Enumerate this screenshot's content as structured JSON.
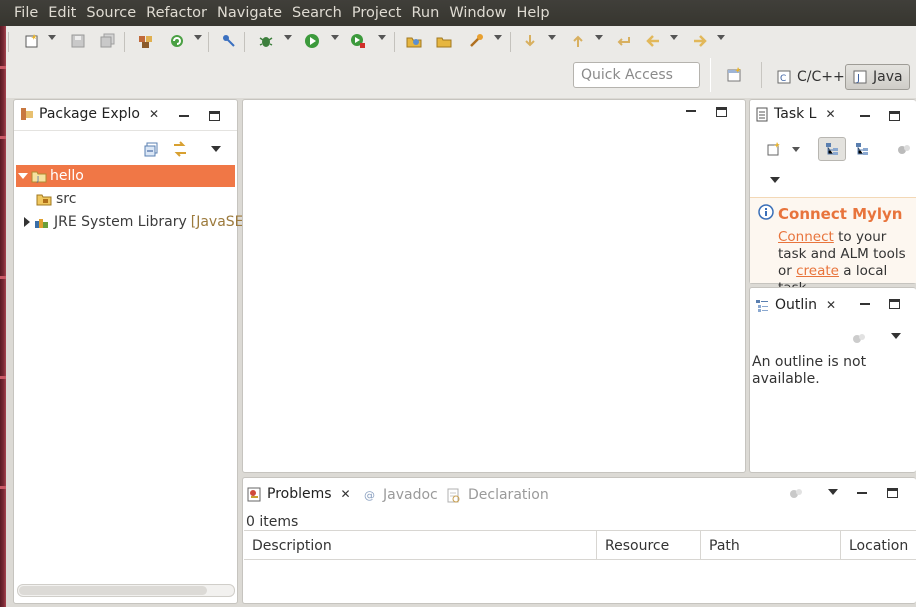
{
  "menubar": {
    "items": [
      {
        "label": "File"
      },
      {
        "label": "Edit"
      },
      {
        "label": "Source"
      },
      {
        "label": "Refactor"
      },
      {
        "label": "Navigate"
      },
      {
        "label": "Search"
      },
      {
        "label": "Project"
      },
      {
        "label": "Run"
      },
      {
        "label": "Window"
      },
      {
        "label": "Help"
      }
    ]
  },
  "toolbar": {
    "quick_access_placeholder": "Quick Access",
    "perspectives": {
      "cpp": "C/C++",
      "java": "Java"
    }
  },
  "package_explorer": {
    "tab_label": "Package Explo",
    "tree": {
      "project": "hello",
      "src": "src",
      "jre_label": "JRE System Library",
      "jre_suffix": "[JavaSE"
    }
  },
  "task_list": {
    "tab_label": "Task L",
    "mylyn": {
      "title": "Connect Mylyn",
      "connect_link": "Connect",
      "text_1": " to your task and ALM tools or ",
      "create_link": "create",
      "text_2": " a local task."
    }
  },
  "outline": {
    "tab_label": "Outlin",
    "message": "An outline is not available."
  },
  "bottom": {
    "tabs": {
      "problems": "Problems",
      "javadoc": "Javadoc",
      "declaration": "Declaration"
    },
    "count": "0 items",
    "columns": [
      "Description",
      "Resource",
      "Path",
      "Location"
    ]
  },
  "colors": {
    "selection": "#f07746",
    "mylyn_accent": "#e8743c",
    "menubar_bg": "#3c3b37"
  }
}
